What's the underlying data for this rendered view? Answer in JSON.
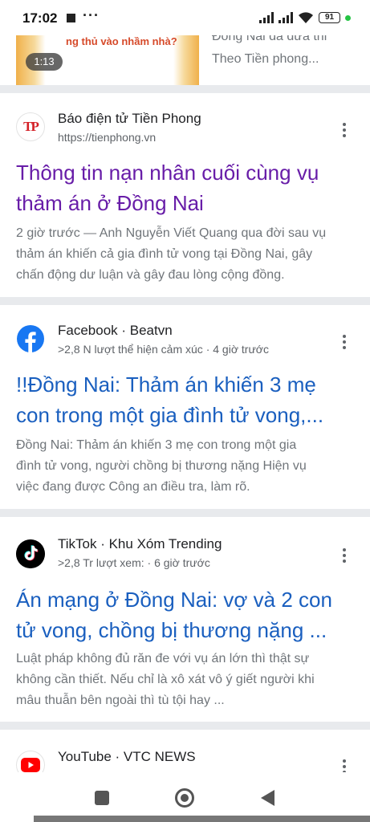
{
  "status_bar": {
    "time": "17:02",
    "dots": "···",
    "battery": "91"
  },
  "top_card": {
    "thumbnail_text": "ng thủ vào nhầm nhà?",
    "duration": "1:13",
    "snippet_line1": "Đồng Nai đã đưa thi",
    "snippet_line2": "Theo Tiền phong..."
  },
  "results": [
    {
      "source_name": "Báo điện tử Tiền Phong",
      "source_sub": "https://tienphong.vn",
      "favicon": "tienphong-logo",
      "favicon_text": "TP",
      "title_line1": "Thông tin nạn nhân cuối cùng vụ",
      "title_line2": "thảm án ở Đồng Nai",
      "snippet_line1": "2 giờ trước — Anh Nguyễn Viết Quang qua đời sau vụ",
      "snippet_line2": "thảm án khiến cả gia đình tử vong tại Đồng Nai, gây",
      "snippet_line3": "chấn động dư luận và gây đau lòng cộng đồng."
    },
    {
      "source_name": "Facebook · Beatvn",
      "source_sub": ">2,8 N lượt thể hiện cảm xúc · 4 giờ trước",
      "favicon": "facebook-logo",
      "title_line1": "!!Đồng Nai: Thảm án khiến 3 mẹ",
      "title_line2": "con trong một gia đình tử vong,...",
      "snippet_line1": "Đồng Nai: Thảm án khiến 3 mẹ con trong một gia",
      "snippet_line2": "đình tử vong, người chồng bị thương nặng Hiện vụ",
      "snippet_line3": "việc đang được Công an điều tra, làm rõ."
    },
    {
      "source_name": "TikTok · Khu Xóm Trending",
      "source_sub": ">2,8 Tr lượt xem: · 6 giờ trước",
      "favicon": "tiktok-logo",
      "title_line1": "Án mạng ở Đồng Nai: vợ và 2 con",
      "title_line2": "tử vong, chồng bị thương nặng ...",
      "snippet_line1": "Luật pháp không đủ răn đe với vụ án lớn thì thật sự",
      "snippet_line2": "không cần thiết. Nếu chỉ là xô xát vô ý giết người khi",
      "snippet_line3": "mâu thuẫn bên ngoài thì tù tội hay ..."
    },
    {
      "source_name": "YouTube · VTC NEWS",
      "source_sub": "",
      "favicon": "youtube-logo"
    }
  ],
  "colors": {
    "visited_link": "#681da8",
    "link": "#1a5fbf",
    "snippet": "#70757a",
    "divider": "#e8eaed"
  }
}
